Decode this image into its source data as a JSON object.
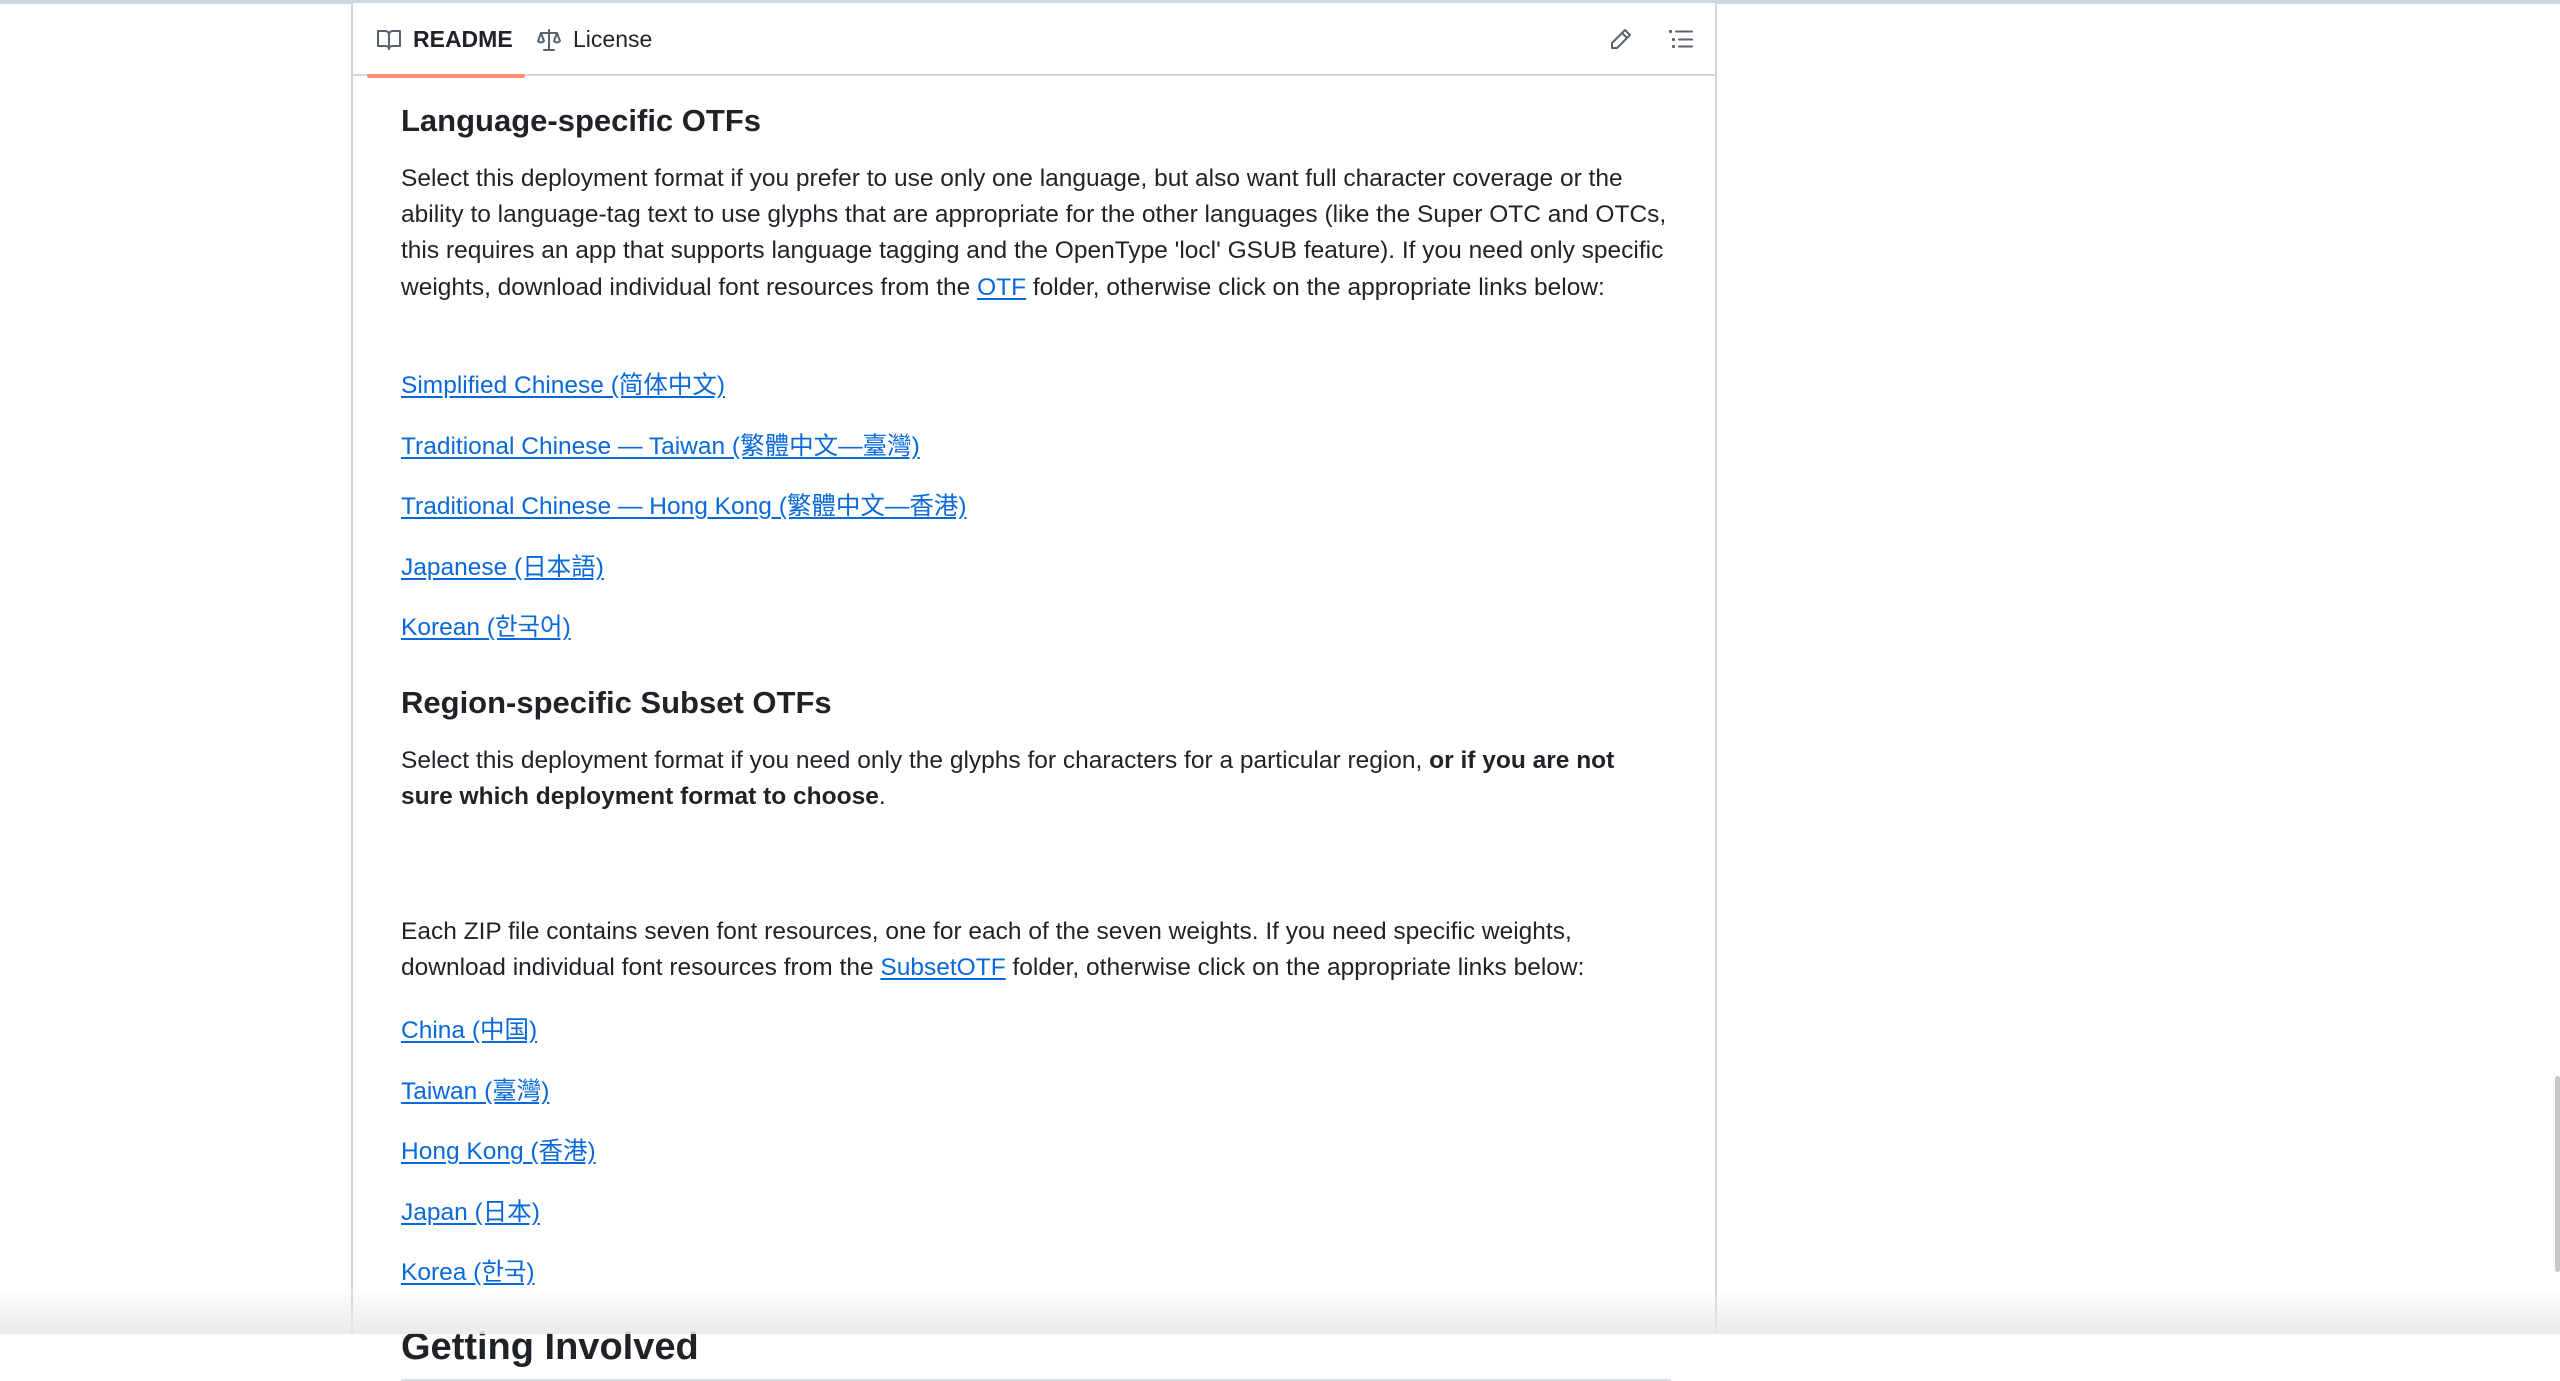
{
  "tabs": {
    "readme": "README",
    "license": "License"
  },
  "icons": {
    "readme": "book-icon",
    "license": "scale-icon",
    "edit": "pencil-icon",
    "toc": "list-icon"
  },
  "colors": {
    "link": "#0969da",
    "active_tab_underline": "#fd8c73",
    "border": "#d0d7de",
    "text": "#1f2328"
  },
  "sections": {
    "lang_otfs": {
      "heading": "Language-specific OTFs",
      "p1_part1": "Select this deployment format if you prefer to use only one language, but also want full character coverage or the ability to language-tag text to use glyphs that are appropriate for the other languages (like the Super OTC and OTCs, this requires an app that supports language tagging and the OpenType 'locl' GSUB feature). If you need only specific weights, download individual font resources from the ",
      "p1_link": "OTF",
      "p1_part2": " folder, otherwise click on the appropriate links below:",
      "links": [
        "Simplified Chinese (简体中文)",
        "Traditional Chinese — Taiwan (繁體中文—臺灣)",
        "Traditional Chinese — Hong Kong (繁體中文—香港)",
        "Japanese (日本語)",
        "Korean (한국어)"
      ]
    },
    "region_otfs": {
      "heading": "Region-specific Subset OTFs",
      "p1_part1": "Select this deployment format if you need only the glyphs for characters for a particular region, ",
      "p1_bold": "or if you are not sure which deployment format to choose",
      "p1_part2": ".",
      "p2_part1": "Each ZIP file contains seven font resources, one for each of the seven weights. If you need specific weights, download individual font resources from the ",
      "p2_link": "SubsetOTF",
      "p2_part2": " folder, otherwise click on the appropriate links below:",
      "links": [
        "China (中国)",
        "Taiwan (臺灣)",
        "Hong Kong (香港)",
        "Japan (日本)",
        "Korea (한국)"
      ]
    },
    "getting_involved": {
      "heading": "Getting Involved"
    }
  }
}
